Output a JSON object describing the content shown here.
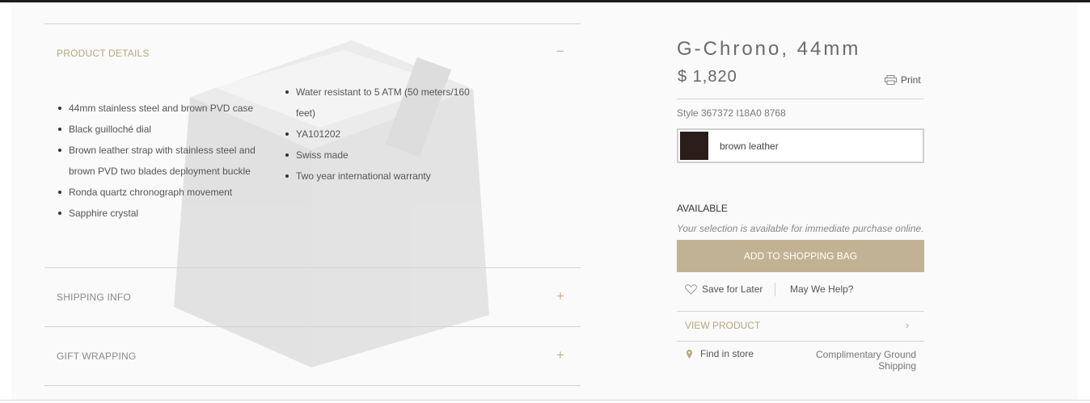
{
  "accordion": {
    "product_details": {
      "title": "PRODUCT DETAILS",
      "toggle": "−",
      "left_items": [
        "44mm stainless steel and brown PVD case",
        "Black guilloché dial",
        "Brown leather strap with stainless steel and brown PVD two blades deployment buckle",
        "Ronda quartz chronograph movement",
        "Sapphire crystal"
      ],
      "right_items": [
        "Water resistant to 5 ATM (50 meters/160 feet)",
        "YA101202",
        "Swiss made",
        "Two year international warranty"
      ]
    },
    "shipping_info": {
      "title": "SHIPPING INFO",
      "toggle": "+"
    },
    "gift_wrapping": {
      "title": "GIFT WRAPPING",
      "toggle": "+"
    }
  },
  "product": {
    "title": "G-Chrono, 44mm",
    "price": "$ 1,820",
    "print_label": "Print",
    "style": "Style 367372 I18A0 8768",
    "variant": {
      "label": "brown leather",
      "color": "#2b1d1a"
    },
    "availability": "AVAILABLE",
    "availability_note": "Your selection is available for immediate purchase online.",
    "add_to_bag": "ADD TO SHOPPING BAG",
    "save_for_later": "Save for Later",
    "may_we_help": "May We Help?",
    "view_product": "VIEW PRODUCT",
    "find_in_store": "Find in store",
    "shipping_note": "Complimentary Ground Shipping"
  },
  "colors": {
    "accent": "#b9a67f",
    "button": "#c2b294",
    "topbar": "#1c1c1c"
  },
  "icons": [
    "print-icon",
    "heart-icon",
    "chevron-right-icon",
    "location-pin-icon",
    "minus-icon",
    "plus-icon"
  ]
}
